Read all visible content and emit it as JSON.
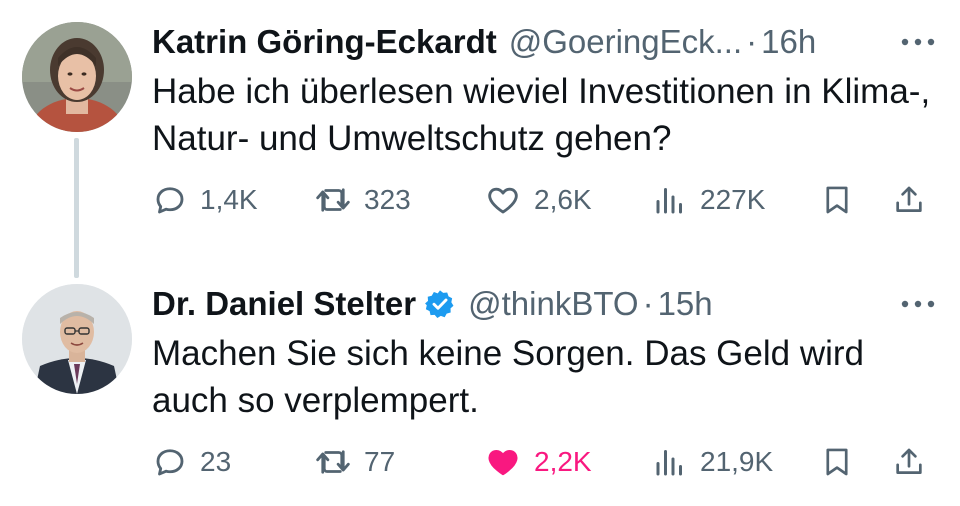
{
  "tweets": [
    {
      "author_name": "Katrin Göring-Eckardt",
      "handle": "@GoeringEck...",
      "separator": "·",
      "time": "16h",
      "verified": false,
      "text": "Habe ich überlesen wieviel Investitionen in Klima-, Natur- und Umweltschutz gehen?",
      "replies": "1,4K",
      "retweets": "323",
      "likes": "2,6K",
      "views": "227K",
      "liked": false
    },
    {
      "author_name": "Dr. Daniel Stelter",
      "handle": "@thinkBTO",
      "separator": "·",
      "time": "15h",
      "verified": true,
      "text": "Machen Sie sich keine Sorgen. Das Geld wird auch so verplempert.",
      "replies": "23",
      "retweets": "77",
      "likes": "2,2K",
      "views": "21,9K",
      "liked": true
    }
  ],
  "colors": {
    "text": "#0f1419",
    "muted": "#536471",
    "like_active": "#f91880",
    "verified": "#1d9bf0",
    "thread_line": "#cfd9de"
  },
  "icons": [
    "reply-icon",
    "retweet-icon",
    "heart-icon",
    "views-icon",
    "bookmark-icon",
    "share-icon",
    "more-icon",
    "verified-badge-icon"
  ]
}
